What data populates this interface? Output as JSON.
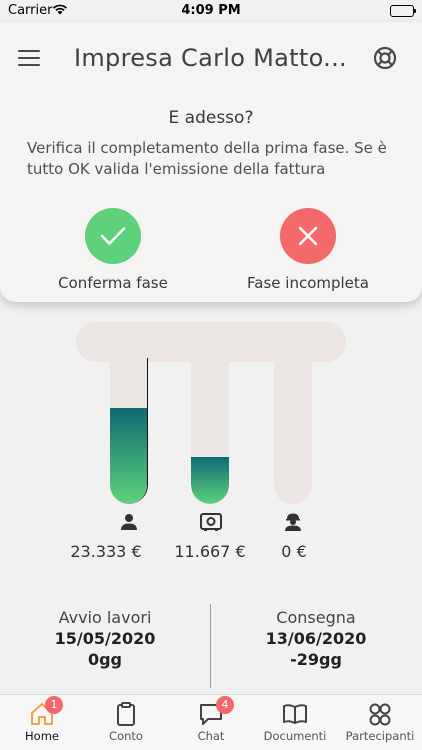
{
  "status_bar": {
    "carrier": "Carrier",
    "time": "4:09 PM"
  },
  "header": {
    "title": "Impresa Carlo Matto..."
  },
  "prompt": {
    "question": "E adesso?",
    "description": "Verifica il completamento della prima fase. Se è tutto OK valida l'emissione della fattura"
  },
  "actions": {
    "confirm_label": "Conferma fase",
    "incomplete_label": "Fase incompleta"
  },
  "accounts": [
    {
      "icon": "person-icon",
      "amount": "23.333 €",
      "fill_fraction": 0.66
    },
    {
      "icon": "safe-icon",
      "amount": "11.667 €",
      "fill_fraction": 0.32
    },
    {
      "icon": "worker-icon",
      "amount": "0 €",
      "fill_fraction": 0
    }
  ],
  "schedule": {
    "start": {
      "title": "Avvio lavori",
      "date": "15/05/2020",
      "days": "0gg"
    },
    "end": {
      "title": "Consegna",
      "date": "13/06/2020",
      "days": "-29gg"
    }
  },
  "tabs": [
    {
      "label": "Home",
      "icon": "home-icon",
      "badge": "1",
      "active": true
    },
    {
      "label": "Conto",
      "icon": "clipboard-icon"
    },
    {
      "label": "Chat",
      "icon": "chat-icon",
      "badge": "4"
    },
    {
      "label": "Documenti",
      "icon": "book-icon"
    },
    {
      "label": "Partecipanti",
      "icon": "participants-icon"
    }
  ],
  "colors": {
    "confirm": "#5fd17a",
    "incomplete": "#f46a6a",
    "active_tab": "#f2a24a",
    "badge": "#f2676b"
  }
}
